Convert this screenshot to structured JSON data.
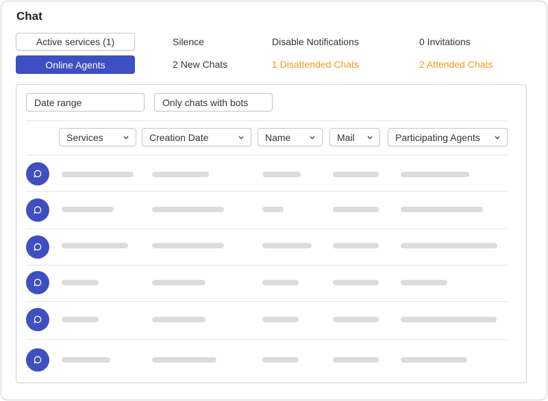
{
  "title": "Chat",
  "buttons": {
    "active_services": "Active services (1)",
    "online_agents": "Online Agents"
  },
  "links": {
    "silence": "Silence",
    "disable_notifications": "Disable Notifications",
    "invitations": "0 Invitations",
    "new_chats": "2 New Chats",
    "disattended_chats": "1 Disattended Chats",
    "attended_chats": "2 Attended Chats"
  },
  "colors": {
    "accent": "#3e4fc1",
    "warning": "#f39a1d",
    "skeleton": "#dcdcdc"
  },
  "filters": {
    "date_range": "Date range",
    "only_bots": "Only chats with bots"
  },
  "columns": {
    "services": "Services",
    "creation_date": "Creation Date",
    "name": "Name",
    "mail": "Mail",
    "agents": "Participating Agents"
  },
  "rows": {
    "icon": "chat-bubble-icon",
    "count": 6,
    "state": "loading-placeholder"
  }
}
